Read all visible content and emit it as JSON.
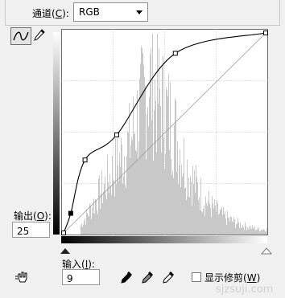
{
  "channel": {
    "label": "通道",
    "accel": "C",
    "value": "RGB"
  },
  "output": {
    "label": "输出",
    "accel": "O",
    "value": "25"
  },
  "input": {
    "label": "输入",
    "accel": "I",
    "value": "9"
  },
  "show_clipping": {
    "label": "显示修剪",
    "accel": "W",
    "checked": false
  },
  "curve": {
    "points": [
      [
        0,
        0
      ],
      [
        9,
        25
      ],
      [
        27,
        93
      ],
      [
        67,
        125
      ],
      [
        141,
        229
      ],
      [
        255,
        255
      ]
    ],
    "selected_point": [
      9,
      25
    ]
  },
  "histogram_color": "#c8c8c8",
  "icons": {
    "curve_tool": "curve-icon",
    "pencil_tool": "pencil-icon",
    "hand_tool": "hand-adjust-icon",
    "black_eyedropper": "black-eyedropper-icon",
    "gray_eyedropper": "gray-eyedropper-icon",
    "white_eyedropper": "white-eyedropper-icon"
  },
  "watermark": "sjzsuji.com"
}
